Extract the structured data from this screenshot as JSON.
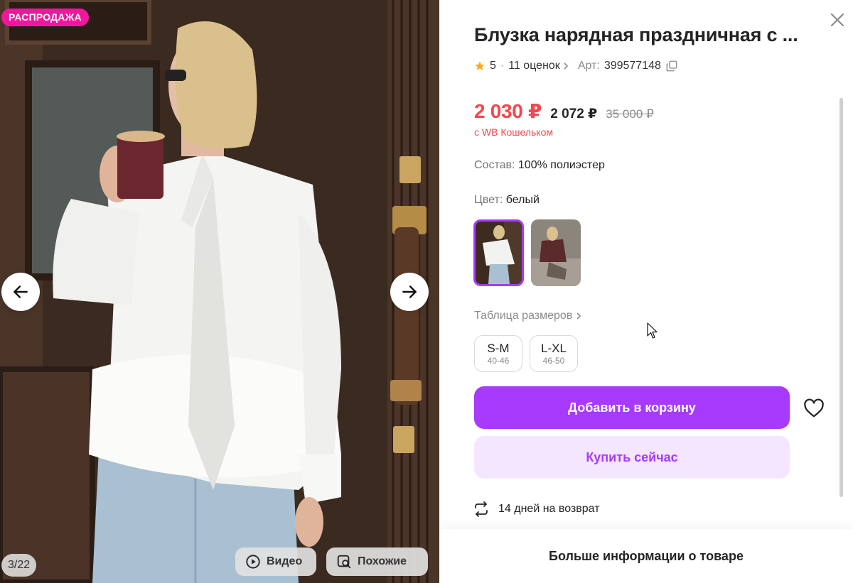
{
  "gallery": {
    "sale_badge": "РАСПРОДАЖА",
    "counter": "3/22",
    "video_label": "Видео",
    "similar_label": "Похожие",
    "icons": [
      "arrow-left-icon",
      "arrow-right-icon",
      "play-icon",
      "search-similar-icon"
    ]
  },
  "product": {
    "title": "Блузка нарядная праздничная с ...",
    "rating": "5",
    "reviews": "11 оценок",
    "article_label": "Арт:",
    "article": "399577148",
    "price_wallet": "2 030 ₽",
    "price": "2 072 ₽",
    "price_old": "35 000 ₽",
    "wallet_note": "с WB Кошельком",
    "composition_label": "Состав:",
    "composition": "100% полиэстер",
    "color_label": "Цвет:",
    "color": "белый",
    "size_table_label": "Таблица размеров",
    "sizes": [
      {
        "size": "S-M",
        "ru": "40-46"
      },
      {
        "size": "L-XL",
        "ru": "46-50"
      }
    ],
    "add_to_cart": "Добавить в корзину",
    "buy_now": "Купить сейчас",
    "returns": "14 дней на возврат",
    "more_info": "Больше информации о товаре"
  },
  "colors": {
    "accent": "#a73afd",
    "accent_light": "#f4e6ff",
    "price_red": "#f5474b",
    "sale_pink": "#f0179b",
    "star": "#ffa81f"
  }
}
